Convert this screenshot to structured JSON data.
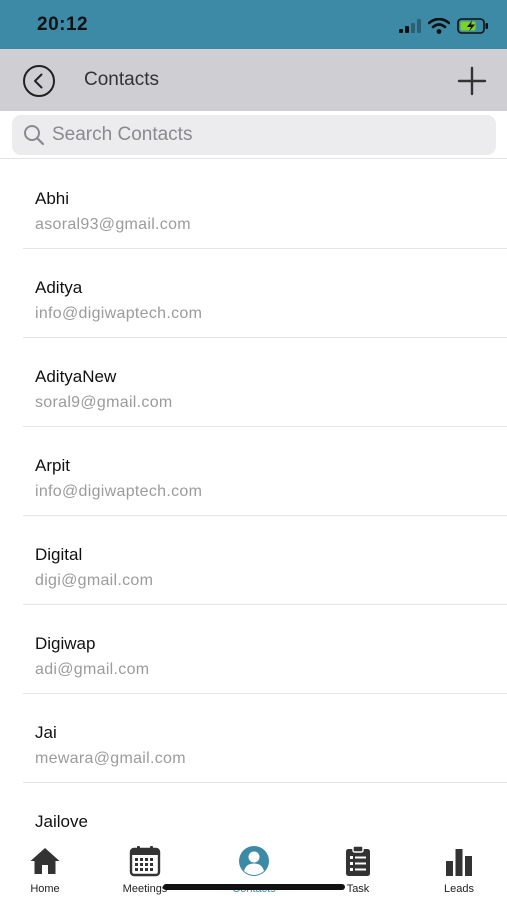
{
  "status_bar": {
    "time": "20:12",
    "icons": [
      "cellular-signal-icon",
      "wifi-icon",
      "battery-charging-icon"
    ]
  },
  "nav": {
    "title": "Contacts",
    "back_icon": "back-circle-icon",
    "add_icon": "plus-icon"
  },
  "search": {
    "placeholder": "Search Contacts",
    "value": ""
  },
  "contacts": [
    {
      "name": "Abhi",
      "email": "asoral93@gmail.com"
    },
    {
      "name": "Aditya",
      "email": "info@digiwaptech.com"
    },
    {
      "name": "AdityaNew",
      "email": "soral9@gmail.com"
    },
    {
      "name": "Arpit",
      "email": "info@digiwaptech.com"
    },
    {
      "name": "Digital",
      "email": "digi@gmail.com"
    },
    {
      "name": "Digiwap",
      "email": "adi@gmail.com"
    },
    {
      "name": "Jai",
      "email": "mewara@gmail.com"
    },
    {
      "name": "Jailove",
      "email": ""
    }
  ],
  "tabs": [
    {
      "label": "Home",
      "icon": "home-icon",
      "active": false
    },
    {
      "label": "Meetings",
      "icon": "calendar-icon",
      "active": false
    },
    {
      "label": "Contacts",
      "icon": "person-icon",
      "active": true
    },
    {
      "label": "Task",
      "icon": "clipboard-icon",
      "active": false
    },
    {
      "label": "Leads",
      "icon": "bar-chart-icon",
      "active": false
    }
  ],
  "colors": {
    "accent": "#3d8aa6",
    "nav_background": "#cfcfd3",
    "search_background": "#ececee",
    "email_text": "#9b9b9b"
  }
}
